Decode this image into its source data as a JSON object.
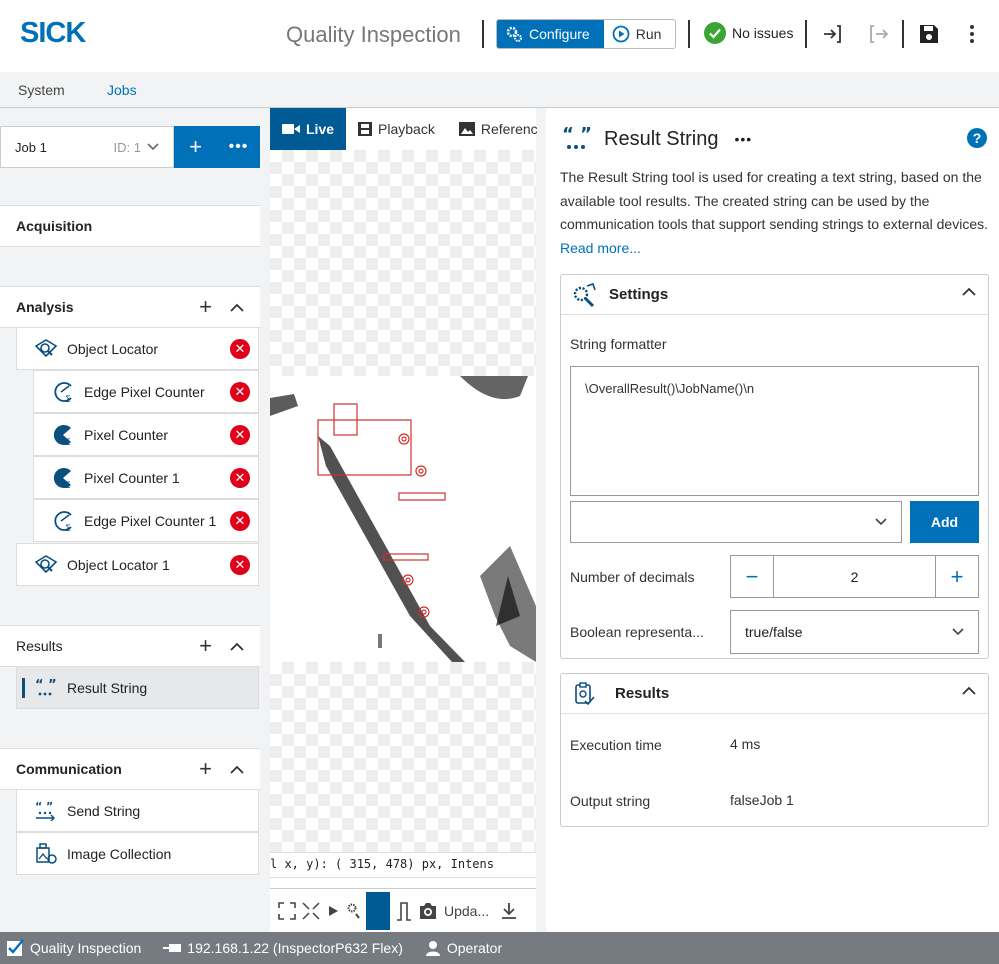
{
  "header": {
    "logo": "SICK",
    "app_title": "Quality Inspection",
    "configure_label": "Configure",
    "run_label": "Run",
    "status_label": "No issues"
  },
  "tabs": [
    {
      "label": "System"
    },
    {
      "label": "Jobs"
    }
  ],
  "left": {
    "job_name": "Job 1",
    "job_id": "ID: 1",
    "acquisition": "Acquisition",
    "analysis": "Analysis",
    "analysis_items": [
      {
        "label": "Object Locator",
        "icon": "object-locator-icon",
        "indent": false
      },
      {
        "label": "Edge Pixel Counter",
        "icon": "edge-pixel-counter-icon",
        "indent": true
      },
      {
        "label": "Pixel Counter",
        "icon": "pixel-counter-icon",
        "indent": true
      },
      {
        "label": "Pixel Counter 1",
        "icon": "pixel-counter-icon",
        "indent": true
      },
      {
        "label": "Edge Pixel Counter 1",
        "icon": "edge-pixel-counter-icon",
        "indent": true
      },
      {
        "label": "Object Locator 1",
        "icon": "object-locator-icon",
        "indent": false
      }
    ],
    "results": "Results",
    "results_items": [
      {
        "label": "Result String",
        "icon": "result-string-icon"
      }
    ],
    "communication": "Communication",
    "communication_items": [
      {
        "label": "Send String",
        "icon": "send-string-icon"
      },
      {
        "label": "Image Collection",
        "icon": "image-collection-icon"
      }
    ]
  },
  "middle": {
    "tabs": [
      {
        "label": "Live"
      },
      {
        "label": "Playback"
      },
      {
        "label": "Referenc"
      }
    ],
    "coords_text": "l x, y): (  315,   478) px, Intens",
    "update_label": "Upda..."
  },
  "right": {
    "title": "Result String",
    "description": "The Result String tool is used for creating a text string, based on the available tool results. The created string can be used by the communication tools that support sending strings to external devices.",
    "read_more": "Read more...",
    "settings": {
      "title": "Settings",
      "string_formatter_label": "String formatter",
      "string_formatter_value": "\\OverallResult()\\JobName()\\n",
      "add_label": "Add",
      "decimals_label": "Number of decimals",
      "decimals_value": "2",
      "boolean_label": "Boolean representa...",
      "boolean_value": "true/false"
    },
    "results": {
      "title": "Results",
      "exec_label": "Execution time",
      "exec_value": "4 ms",
      "output_label": "Output string",
      "output_value": "falseJob 1"
    }
  },
  "statusbar": {
    "app": "Quality Inspection",
    "device": "192.168.1.22 (InspectorP632 Flex)",
    "user": "Operator"
  },
  "colors": {
    "accent": "#0071b9",
    "error": "#e1001a",
    "ok": "#3aa535"
  }
}
